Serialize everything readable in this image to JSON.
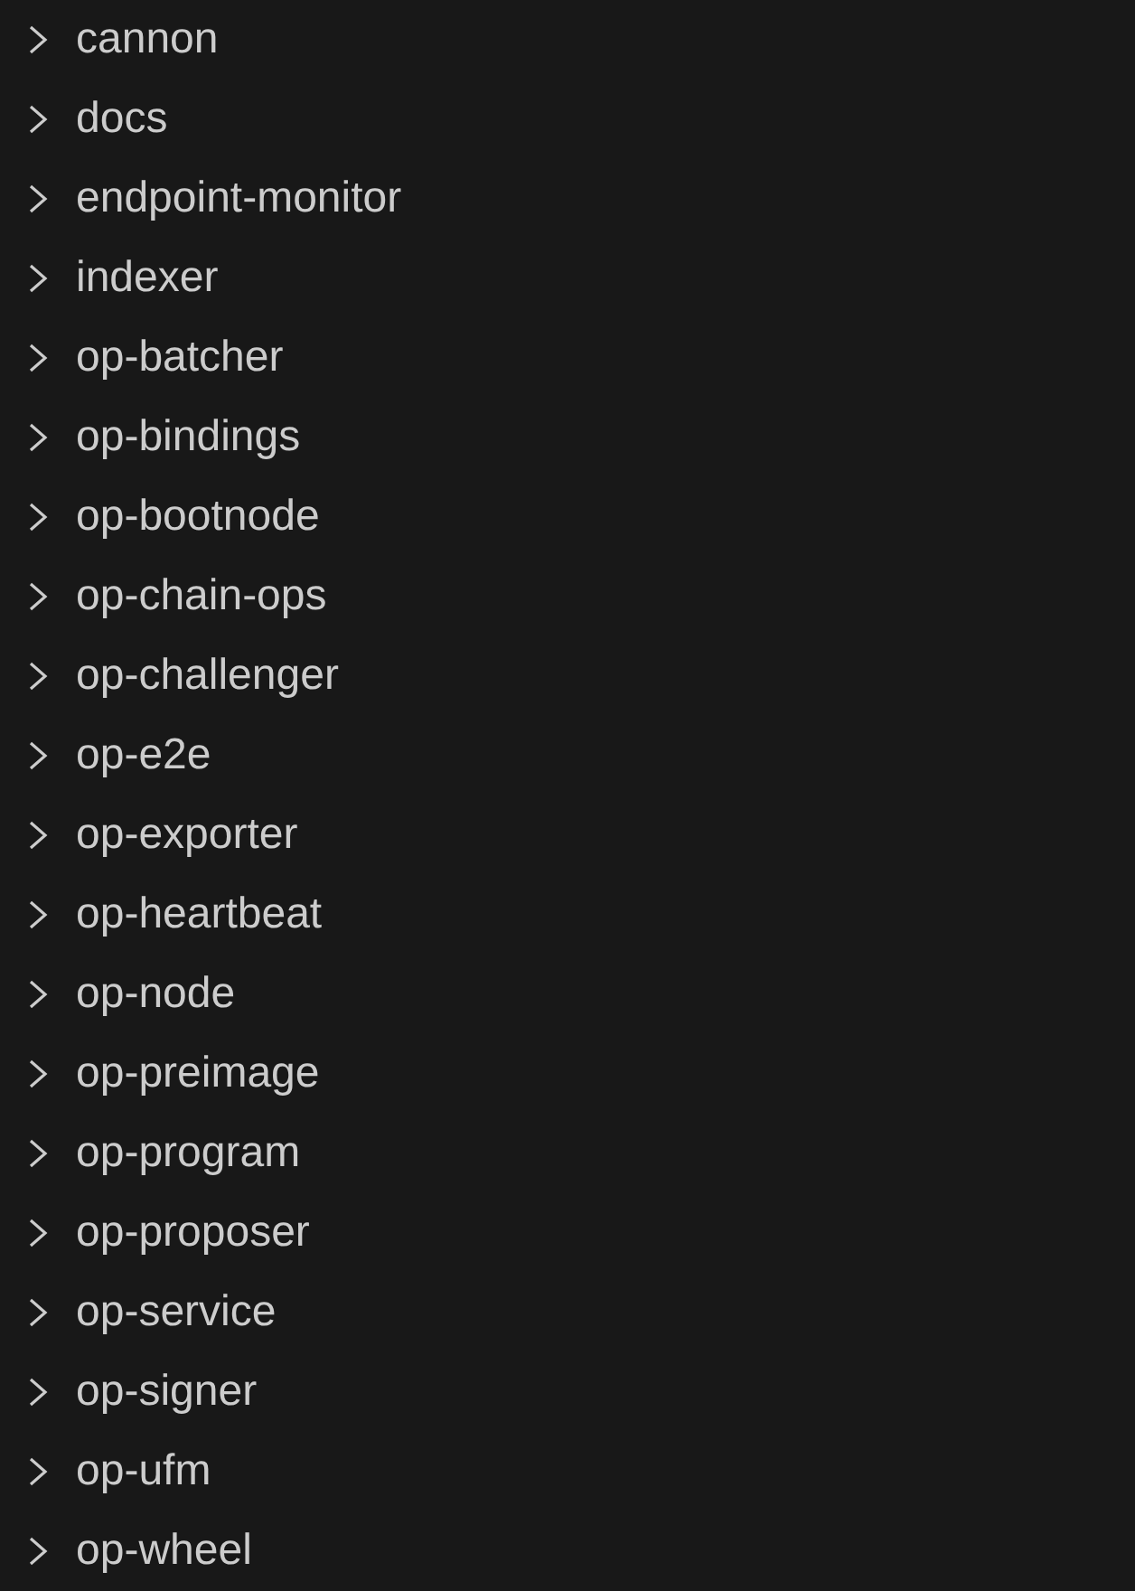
{
  "explorer": {
    "folders": [
      {
        "label": "cannon",
        "expanded": false
      },
      {
        "label": "docs",
        "expanded": false
      },
      {
        "label": "endpoint-monitor",
        "expanded": false
      },
      {
        "label": "indexer",
        "expanded": false
      },
      {
        "label": "op-batcher",
        "expanded": false
      },
      {
        "label": "op-bindings",
        "expanded": false
      },
      {
        "label": "op-bootnode",
        "expanded": false
      },
      {
        "label": "op-chain-ops",
        "expanded": false
      },
      {
        "label": "op-challenger",
        "expanded": false
      },
      {
        "label": "op-e2e",
        "expanded": false
      },
      {
        "label": "op-exporter",
        "expanded": false
      },
      {
        "label": "op-heartbeat",
        "expanded": false
      },
      {
        "label": "op-node",
        "expanded": false
      },
      {
        "label": "op-preimage",
        "expanded": false
      },
      {
        "label": "op-program",
        "expanded": false
      },
      {
        "label": "op-proposer",
        "expanded": false
      },
      {
        "label": "op-service",
        "expanded": false
      },
      {
        "label": "op-signer",
        "expanded": false
      },
      {
        "label": "op-ufm",
        "expanded": false
      },
      {
        "label": "op-wheel",
        "expanded": false
      }
    ]
  }
}
